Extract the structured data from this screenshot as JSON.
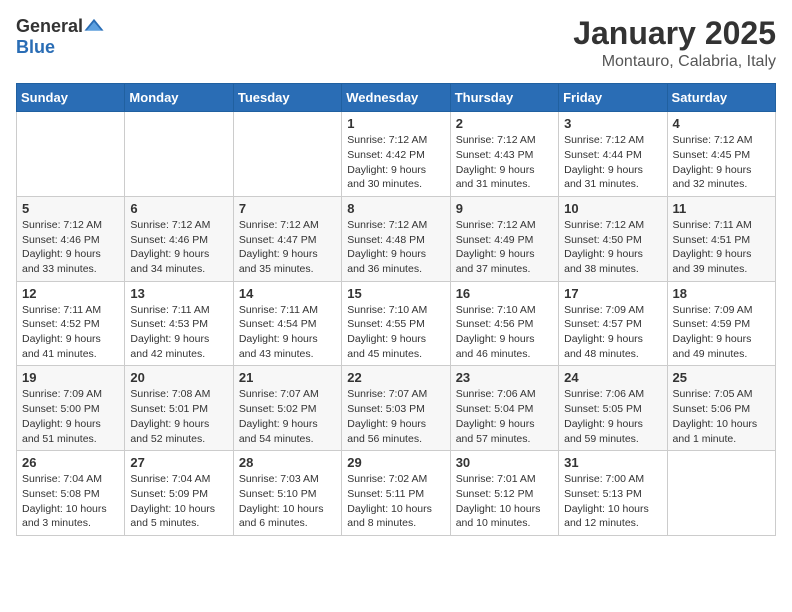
{
  "header": {
    "logo_general": "General",
    "logo_blue": "Blue",
    "title": "January 2025",
    "subtitle": "Montauro, Calabria, Italy"
  },
  "days_of_week": [
    "Sunday",
    "Monday",
    "Tuesday",
    "Wednesday",
    "Thursday",
    "Friday",
    "Saturday"
  ],
  "weeks": [
    [
      {
        "day": "",
        "info": ""
      },
      {
        "day": "",
        "info": ""
      },
      {
        "day": "",
        "info": ""
      },
      {
        "day": "1",
        "info": "Sunrise: 7:12 AM\nSunset: 4:42 PM\nDaylight: 9 hours\nand 30 minutes."
      },
      {
        "day": "2",
        "info": "Sunrise: 7:12 AM\nSunset: 4:43 PM\nDaylight: 9 hours\nand 31 minutes."
      },
      {
        "day": "3",
        "info": "Sunrise: 7:12 AM\nSunset: 4:44 PM\nDaylight: 9 hours\nand 31 minutes."
      },
      {
        "day": "4",
        "info": "Sunrise: 7:12 AM\nSunset: 4:45 PM\nDaylight: 9 hours\nand 32 minutes."
      }
    ],
    [
      {
        "day": "5",
        "info": "Sunrise: 7:12 AM\nSunset: 4:46 PM\nDaylight: 9 hours\nand 33 minutes."
      },
      {
        "day": "6",
        "info": "Sunrise: 7:12 AM\nSunset: 4:46 PM\nDaylight: 9 hours\nand 34 minutes."
      },
      {
        "day": "7",
        "info": "Sunrise: 7:12 AM\nSunset: 4:47 PM\nDaylight: 9 hours\nand 35 minutes."
      },
      {
        "day": "8",
        "info": "Sunrise: 7:12 AM\nSunset: 4:48 PM\nDaylight: 9 hours\nand 36 minutes."
      },
      {
        "day": "9",
        "info": "Sunrise: 7:12 AM\nSunset: 4:49 PM\nDaylight: 9 hours\nand 37 minutes."
      },
      {
        "day": "10",
        "info": "Sunrise: 7:12 AM\nSunset: 4:50 PM\nDaylight: 9 hours\nand 38 minutes."
      },
      {
        "day": "11",
        "info": "Sunrise: 7:11 AM\nSunset: 4:51 PM\nDaylight: 9 hours\nand 39 minutes."
      }
    ],
    [
      {
        "day": "12",
        "info": "Sunrise: 7:11 AM\nSunset: 4:52 PM\nDaylight: 9 hours\nand 41 minutes."
      },
      {
        "day": "13",
        "info": "Sunrise: 7:11 AM\nSunset: 4:53 PM\nDaylight: 9 hours\nand 42 minutes."
      },
      {
        "day": "14",
        "info": "Sunrise: 7:11 AM\nSunset: 4:54 PM\nDaylight: 9 hours\nand 43 minutes."
      },
      {
        "day": "15",
        "info": "Sunrise: 7:10 AM\nSunset: 4:55 PM\nDaylight: 9 hours\nand 45 minutes."
      },
      {
        "day": "16",
        "info": "Sunrise: 7:10 AM\nSunset: 4:56 PM\nDaylight: 9 hours\nand 46 minutes."
      },
      {
        "day": "17",
        "info": "Sunrise: 7:09 AM\nSunset: 4:57 PM\nDaylight: 9 hours\nand 48 minutes."
      },
      {
        "day": "18",
        "info": "Sunrise: 7:09 AM\nSunset: 4:59 PM\nDaylight: 9 hours\nand 49 minutes."
      }
    ],
    [
      {
        "day": "19",
        "info": "Sunrise: 7:09 AM\nSunset: 5:00 PM\nDaylight: 9 hours\nand 51 minutes."
      },
      {
        "day": "20",
        "info": "Sunrise: 7:08 AM\nSunset: 5:01 PM\nDaylight: 9 hours\nand 52 minutes."
      },
      {
        "day": "21",
        "info": "Sunrise: 7:07 AM\nSunset: 5:02 PM\nDaylight: 9 hours\nand 54 minutes."
      },
      {
        "day": "22",
        "info": "Sunrise: 7:07 AM\nSunset: 5:03 PM\nDaylight: 9 hours\nand 56 minutes."
      },
      {
        "day": "23",
        "info": "Sunrise: 7:06 AM\nSunset: 5:04 PM\nDaylight: 9 hours\nand 57 minutes."
      },
      {
        "day": "24",
        "info": "Sunrise: 7:06 AM\nSunset: 5:05 PM\nDaylight: 9 hours\nand 59 minutes."
      },
      {
        "day": "25",
        "info": "Sunrise: 7:05 AM\nSunset: 5:06 PM\nDaylight: 10 hours\nand 1 minute."
      }
    ],
    [
      {
        "day": "26",
        "info": "Sunrise: 7:04 AM\nSunset: 5:08 PM\nDaylight: 10 hours\nand 3 minutes."
      },
      {
        "day": "27",
        "info": "Sunrise: 7:04 AM\nSunset: 5:09 PM\nDaylight: 10 hours\nand 5 minutes."
      },
      {
        "day": "28",
        "info": "Sunrise: 7:03 AM\nSunset: 5:10 PM\nDaylight: 10 hours\nand 6 minutes."
      },
      {
        "day": "29",
        "info": "Sunrise: 7:02 AM\nSunset: 5:11 PM\nDaylight: 10 hours\nand 8 minutes."
      },
      {
        "day": "30",
        "info": "Sunrise: 7:01 AM\nSunset: 5:12 PM\nDaylight: 10 hours\nand 10 minutes."
      },
      {
        "day": "31",
        "info": "Sunrise: 7:00 AM\nSunset: 5:13 PM\nDaylight: 10 hours\nand 12 minutes."
      },
      {
        "day": "",
        "info": ""
      }
    ]
  ]
}
